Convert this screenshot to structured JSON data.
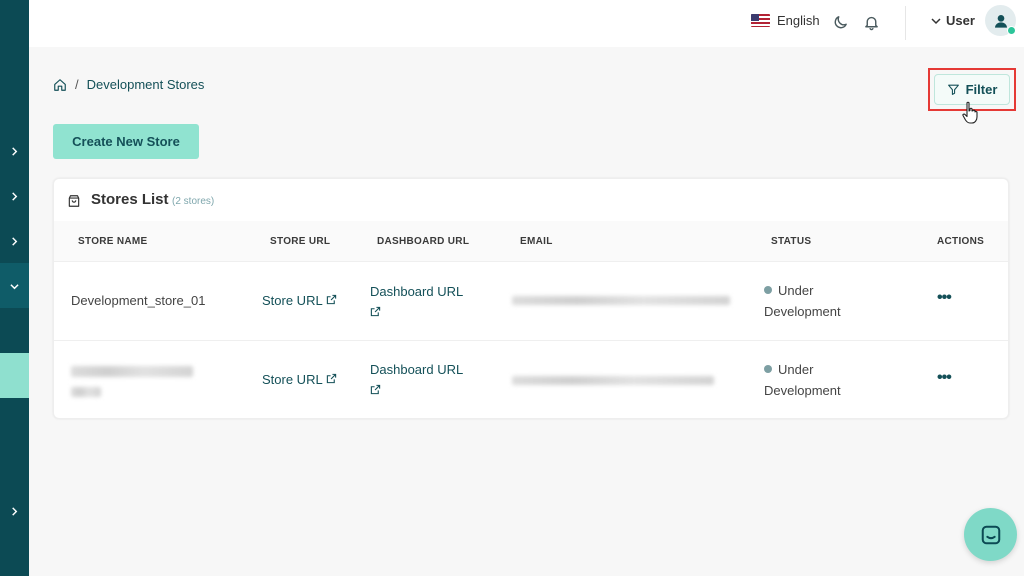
{
  "header": {
    "language": "English",
    "user_label": "User"
  },
  "breadcrumb": {
    "current": "Development Stores",
    "separator": "/"
  },
  "filter": {
    "label": "Filter"
  },
  "actions": {
    "create_label": "Create New Store"
  },
  "stores": {
    "title": "Stores List",
    "count": "(2 stores)",
    "columns": [
      "STORE NAME",
      "STORE URL",
      "DASHBOARD URL",
      "EMAIL",
      "STATUS",
      "ACTIONS"
    ],
    "rows": [
      {
        "name": "Development_store_01",
        "store_url": "Store URL",
        "dashboard_url": "Dashboard URL",
        "status_line1": "Under",
        "status_line2": "Development",
        "actions": "•••"
      },
      {
        "name": "",
        "store_url": "Store URL",
        "dashboard_url": "Dashboard URL",
        "status_line1": "Under",
        "status_line2": "Development",
        "actions": "•••"
      }
    ]
  },
  "icons": [
    "chevron-right-icon",
    "chevron-down-icon",
    "flag-us-icon",
    "moon-icon",
    "bell-icon",
    "user-icon",
    "home-icon",
    "filter-icon",
    "bag-icon",
    "external-link-icon",
    "chat-icon",
    "hand-cursor-icon"
  ],
  "colors": {
    "sidebar": "#0c4a54",
    "accent": "#90e3d0",
    "link": "#145058",
    "highlight_border": "#e53935",
    "online": "#2cc59a"
  }
}
